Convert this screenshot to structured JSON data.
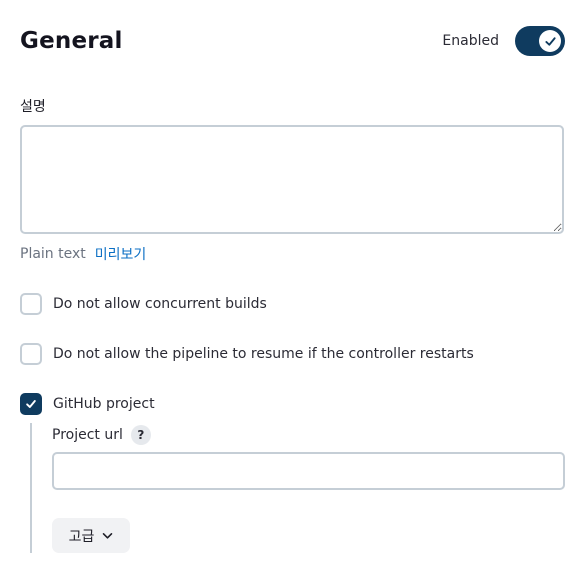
{
  "section": {
    "title": "General",
    "enabled_label": "Enabled",
    "enabled": true
  },
  "description": {
    "label": "설명",
    "value": "",
    "plain_text_label": "Plain text",
    "preview_link": "미리보기"
  },
  "options": [
    {
      "label": "Do not allow concurrent builds",
      "checked": false
    },
    {
      "label": "Do not allow the pipeline to resume if the controller restarts",
      "checked": false
    },
    {
      "label": "GitHub project",
      "checked": true
    }
  ],
  "github_project": {
    "url_label": "Project url",
    "help_icon": "?",
    "url_value": "",
    "advanced_button": "고급"
  },
  "icons": {
    "toggle": "check-icon",
    "help": "question-mark-icon",
    "advanced": "chevron-down-icon"
  },
  "colors": {
    "accent": "#0f3b5f",
    "link": "#0b6fc4",
    "border": "#c5ced6"
  }
}
